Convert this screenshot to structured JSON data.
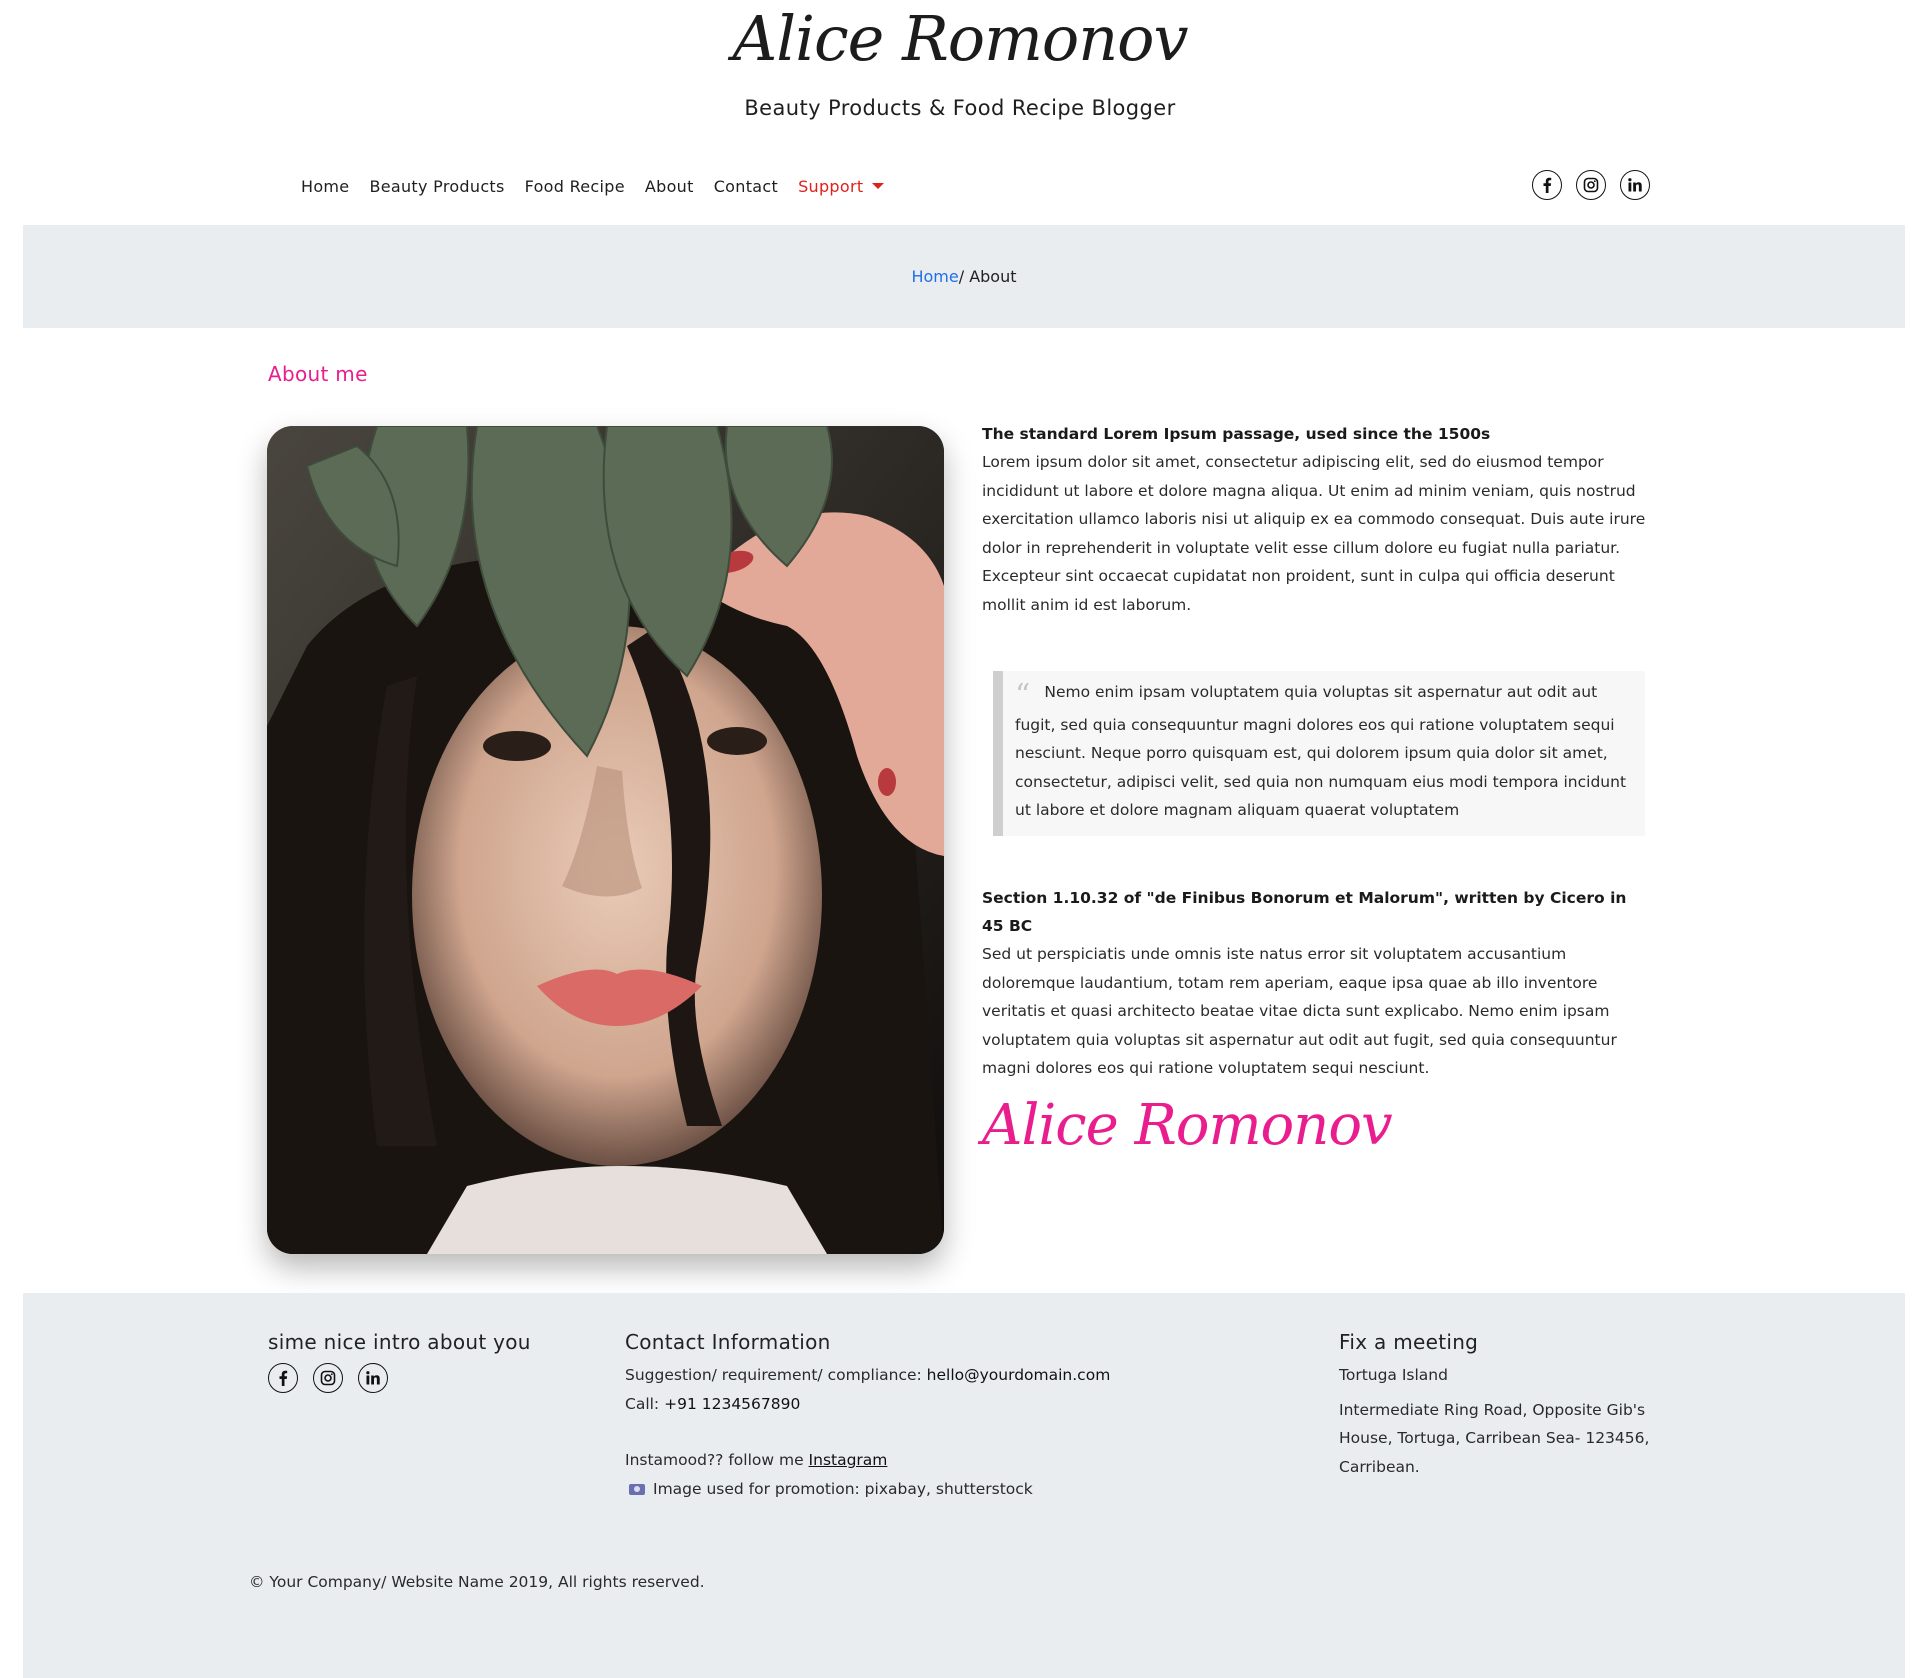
{
  "header": {
    "brand": "Alice Romonov",
    "tagline": "Beauty Products & Food Recipe Blogger"
  },
  "nav": {
    "items": [
      "Home",
      "Beauty Products",
      "Food Recipe",
      "About",
      "Contact"
    ],
    "support_label": "Support"
  },
  "social": {
    "icons": [
      "facebook-icon",
      "instagram-icon",
      "linkedin-icon"
    ]
  },
  "breadcrumb": {
    "home": "Home",
    "separator": "/ ",
    "current": "About"
  },
  "about": {
    "heading": "About me",
    "image_alt": "portrait of a woman with a leaf over her face",
    "block1_title": "The standard Lorem Ipsum passage, used since the 1500s",
    "block1_text": "Lorem ipsum dolor sit amet, consectetur adipiscing elit, sed do eiusmod tempor incididunt ut labore et dolore magna aliqua. Ut enim ad minim veniam, quis nostrud exercitation ullamco laboris nisi ut aliquip ex ea commodo consequat. Duis aute irure dolor in reprehenderit in voluptate velit esse cillum dolore eu fugiat nulla pariatur. Excepteur sint occaecat cupidatat non proident, sunt in culpa qui officia deserunt mollit anim id est laborum.",
    "quote_mark": "“",
    "quote": "Nemo enim ipsam voluptatem quia voluptas sit aspernatur aut odit aut fugit, sed quia consequuntur magni dolores eos qui ratione voluptatem sequi nesciunt. Neque porro quisquam est, qui dolorem ipsum quia dolor sit amet, consectetur, adipisci velit, sed quia non numquam eius modi tempora incidunt ut labore et dolore magnam aliquam quaerat voluptatem",
    "block2_title": "Section 1.10.32 of \"de Finibus Bonorum et Malorum\", written by Cicero in 45 BC",
    "block2_text": "Sed ut perspiciatis unde omnis iste natus error sit voluptatem accusantium doloremque laudantium, totam rem aperiam, eaque ipsa quae ab illo inventore veritatis et quasi architecto beatae vitae dicta sunt explicabo. Nemo enim ipsam voluptatem quia voluptas sit aspernatur aut odit aut fugit, sed quia consequuntur magni dolores eos qui ratione voluptatem sequi nesciunt.",
    "signature": "Alice Romonov"
  },
  "footer": {
    "intro": "sime nice intro about you",
    "contact_heading": "Contact Information",
    "suggestion_label": "Suggestion/ requirement/ compliance: ",
    "email": "hello@yourdomain.com",
    "call_label": "Call: ",
    "phone": "+91 1234567890",
    "insta_label": "Instamood?? follow me ",
    "insta_link": "Instagram",
    "image_credit": "Image used for promotion: pixabay, shutterstock",
    "meeting_heading": "Fix a meeting",
    "meeting_place": "Tortuga Island",
    "meeting_address": "Intermediate Ring Road, Opposite Gib's House, Tortuga, Carribean Sea- 123456, Carribean.",
    "copyright": "© Your Company/ Website Name 2019, All rights reserved."
  },
  "colors": {
    "accent_pink": "#ea1d8e",
    "support_red": "#e0201a",
    "link_blue": "#1f6fe8",
    "band_gray": "#eaedf0"
  }
}
